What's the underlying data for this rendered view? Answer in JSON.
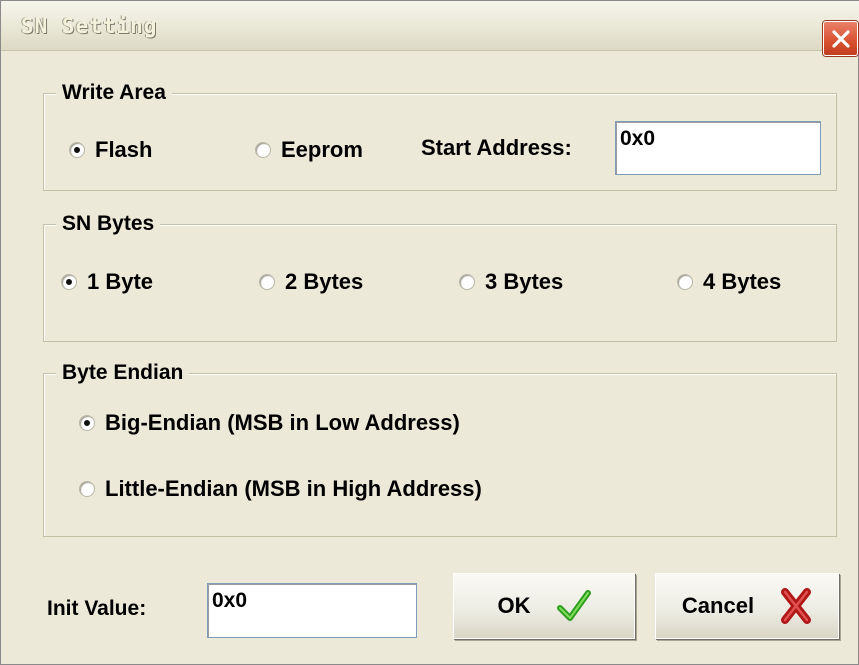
{
  "window": {
    "title": "SN Setting"
  },
  "write_area": {
    "legend": "Write Area",
    "options": [
      "Flash",
      "Eeprom"
    ],
    "selected": "Flash",
    "start_address_label": "Start Address:",
    "start_address_value": "0x0"
  },
  "sn_bytes": {
    "legend": "SN Bytes",
    "options": [
      "1 Byte",
      "2 Bytes",
      "3 Bytes",
      "4 Bytes"
    ],
    "selected": "1 Byte"
  },
  "byte_endian": {
    "legend": "Byte Endian",
    "options": [
      "Big-Endian (MSB in Low Address)",
      "Little-Endian (MSB in High Address)"
    ],
    "selected": "Big-Endian (MSB in Low Address)"
  },
  "init_value": {
    "label": "Init Value:",
    "value": "0x0"
  },
  "buttons": {
    "ok": "OK",
    "cancel": "Cancel"
  },
  "icons": {
    "close": "close-icon",
    "ok": "check-icon",
    "cancel": "x-mark-icon"
  },
  "colors": {
    "dialog_bg": "#ece9d8",
    "close_red": "#d8502f",
    "check_green": "#2f9e1f",
    "cancel_red": "#b01818"
  }
}
